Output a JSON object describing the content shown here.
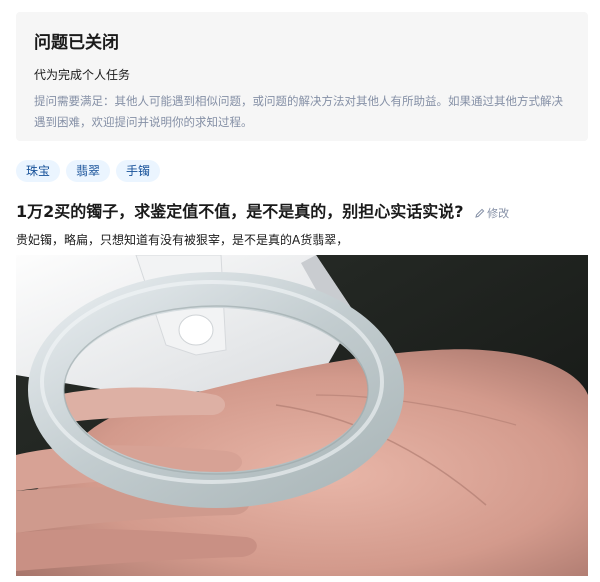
{
  "notice": {
    "title": "问题已关闭",
    "subtitle": "代为完成个人任务",
    "description": "提问需要满足：其他人可能遇到相似问题，或问题的解决方法对其他人有所助益。如果通过其他方式解决遇到困难，欢迎提问并说明你的求知过程。"
  },
  "tags": [
    "珠宝",
    "翡翠",
    "手镯"
  ],
  "question": {
    "title": "1万2买的镯子，求鉴定值不值，是不是真的，别担心实话实说?",
    "edit_label": "修改",
    "body": "贵妃镯，略扁，只想知道有没有被狠宰，是不是真的A货翡翠，"
  },
  "colors": {
    "tag_text": "#175199",
    "tag_bg": "#ebf5ff",
    "muted": "#8590a6",
    "notice_bg": "#f6f6f6"
  }
}
